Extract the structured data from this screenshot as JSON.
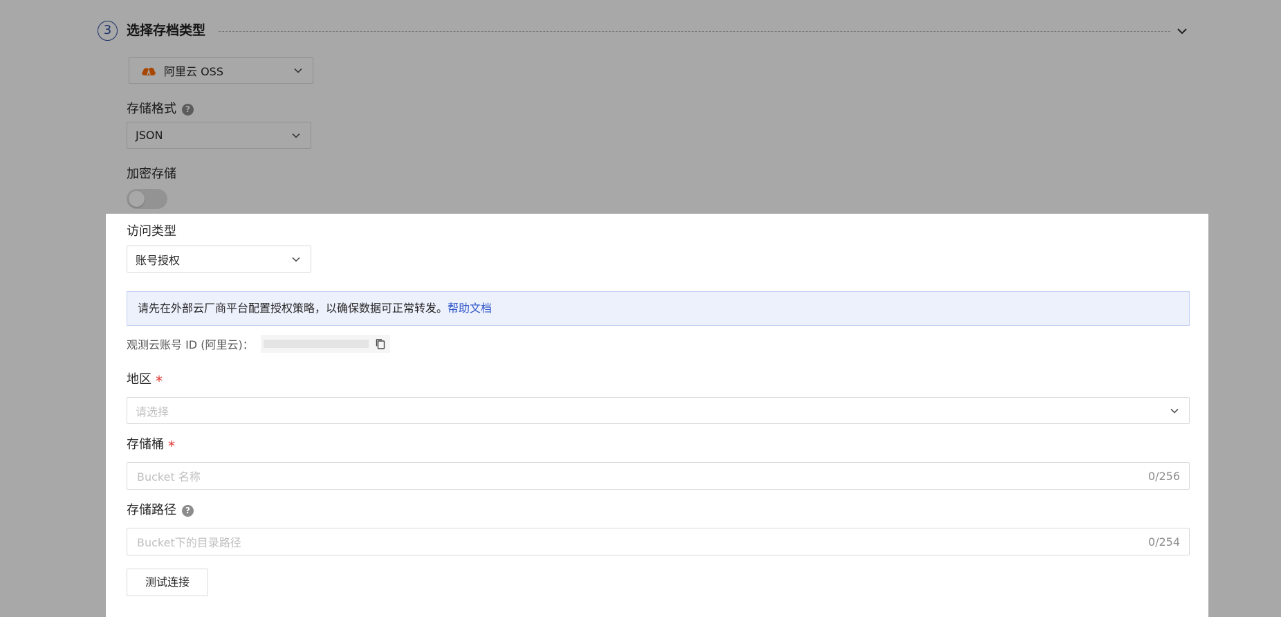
{
  "step": {
    "number": "3",
    "title": "选择存档类型"
  },
  "archive_type": {
    "selected": "阿里云 OSS",
    "icon": "alibaba-cloud-icon"
  },
  "storage_format": {
    "label": "存储格式",
    "selected": "JSON"
  },
  "encryption": {
    "label": "加密存储",
    "enabled": false
  },
  "access_type": {
    "label": "访问类型",
    "selected": "账号授权"
  },
  "notice": {
    "text": "请先在外部云厂商平台配置授权策略，以确保数据可正常转发。",
    "link_text": "帮助文档"
  },
  "account": {
    "label": "观测云账号 ID (阿里云)："
  },
  "region": {
    "label": "地区",
    "required_mark": "*",
    "placeholder": "请选择"
  },
  "bucket": {
    "label": "存储桶",
    "required_mark": "*",
    "placeholder": "Bucket 名称",
    "counter": "0/256"
  },
  "path": {
    "label": "存储路径",
    "placeholder": "Bucket下的目录路径",
    "counter": "0/254"
  },
  "test_button": {
    "label": "测试连接"
  },
  "colors": {
    "accent": "#2b4a9e",
    "link": "#2e55c7",
    "required": "#e0332e",
    "notice_bg": "#edf1fc",
    "overlay": "rgba(0,0,0,0.34)"
  }
}
